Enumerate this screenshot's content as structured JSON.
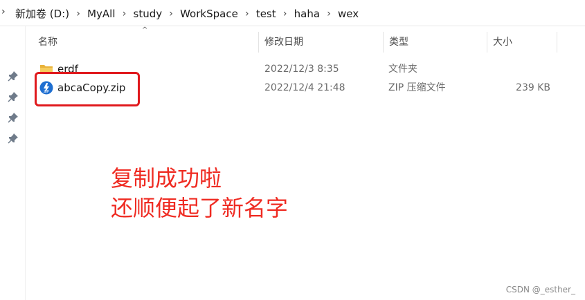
{
  "breadcrumb": {
    "items": [
      "新加卷 (D:)",
      "MyAll",
      "study",
      "WorkSpace",
      "test",
      "haha",
      "wex"
    ]
  },
  "columns": {
    "name": "名称",
    "date": "修改日期",
    "type": "类型",
    "size": "大小"
  },
  "files": [
    {
      "name": "erdf",
      "date": "2022/12/3 8:35",
      "type": "文件夹",
      "size": "",
      "icon": "folder-icon"
    },
    {
      "name": "abcaCopy.zip",
      "date": "2022/12/4 21:48",
      "type": "ZIP 压缩文件",
      "size": "239 KB",
      "icon": "zip-file-icon"
    }
  ],
  "annotation": {
    "line1": "复制成功啦",
    "line2": "还顺便起了新名字"
  },
  "watermark": "CSDN @_esther_",
  "colors": {
    "annotation": "#ef2b22",
    "highlight": "#e0191d",
    "folder": "#f2c14e",
    "zip_icon": "#1f6fd1"
  }
}
